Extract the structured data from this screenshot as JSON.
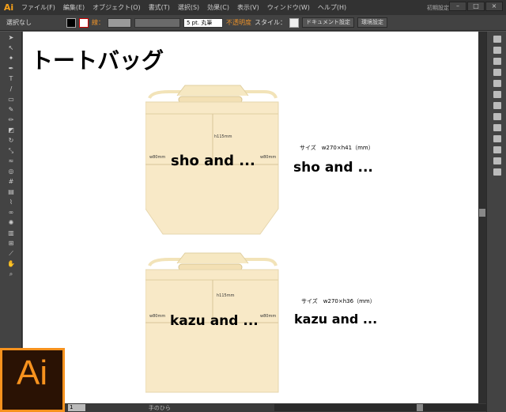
{
  "app": {
    "logo": "Ai",
    "workspace": "初期設定",
    "brand_color": "#f7921e"
  },
  "menu": [
    "ファイル(F)",
    "編集(E)",
    "オブジェクト(O)",
    "書式(T)",
    "選択(S)",
    "効果(C)",
    "表示(V)",
    "ウィンドウ(W)",
    "ヘルプ(H)"
  ],
  "control": {
    "selection": "選択なし",
    "stroke_label": "線：",
    "brush": "5 pt. 丸筆",
    "opacity": "不透明度",
    "style": "スタイル：",
    "doc_settings": "ドキュメント設定",
    "prefs": "環境設定"
  },
  "document": {
    "title": "トートバッグ",
    "bags": [
      {
        "logo": "sho and ...",
        "height_label": "h115mm",
        "left_label": "w80mm",
        "right_label": "w80mm",
        "size": "サイズ　w270×h41（mm）"
      },
      {
        "logo": "kazu and ...",
        "height_label": "h115mm",
        "left_label": "w80mm",
        "right_label": "w80mm",
        "size": "サイズ　w270×h36（mm）"
      }
    ]
  },
  "status": {
    "page": "1",
    "tool": "手のひら"
  }
}
